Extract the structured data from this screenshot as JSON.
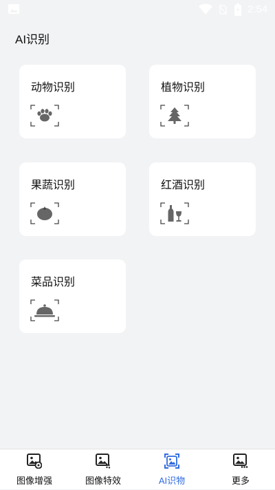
{
  "status_bar": {
    "time": "2:54"
  },
  "page": {
    "title": "AI识别"
  },
  "cards": [
    {
      "label": "动物识别",
      "icon": "paw-icon"
    },
    {
      "label": "植物识别",
      "icon": "tree-icon"
    },
    {
      "label": "果蔬识别",
      "icon": "tomato-icon"
    },
    {
      "label": "红酒识别",
      "icon": "wine-icon"
    },
    {
      "label": "菜品识别",
      "icon": "dish-cloche-icon"
    }
  ],
  "bottom_nav": {
    "items": [
      {
        "label": "图像增强",
        "icon": "image-enhance-icon",
        "active": false
      },
      {
        "label": "图像特效",
        "icon": "image-effects-icon",
        "active": false
      },
      {
        "label": "AI识物",
        "icon": "ai-recognize-icon",
        "active": true
      },
      {
        "label": "更多",
        "icon": "more-icon",
        "active": false
      }
    ]
  },
  "colors": {
    "background": "#f2f3f5",
    "card": "#ffffff",
    "accent": "#2f6be0",
    "icon_gray": "#666666"
  }
}
